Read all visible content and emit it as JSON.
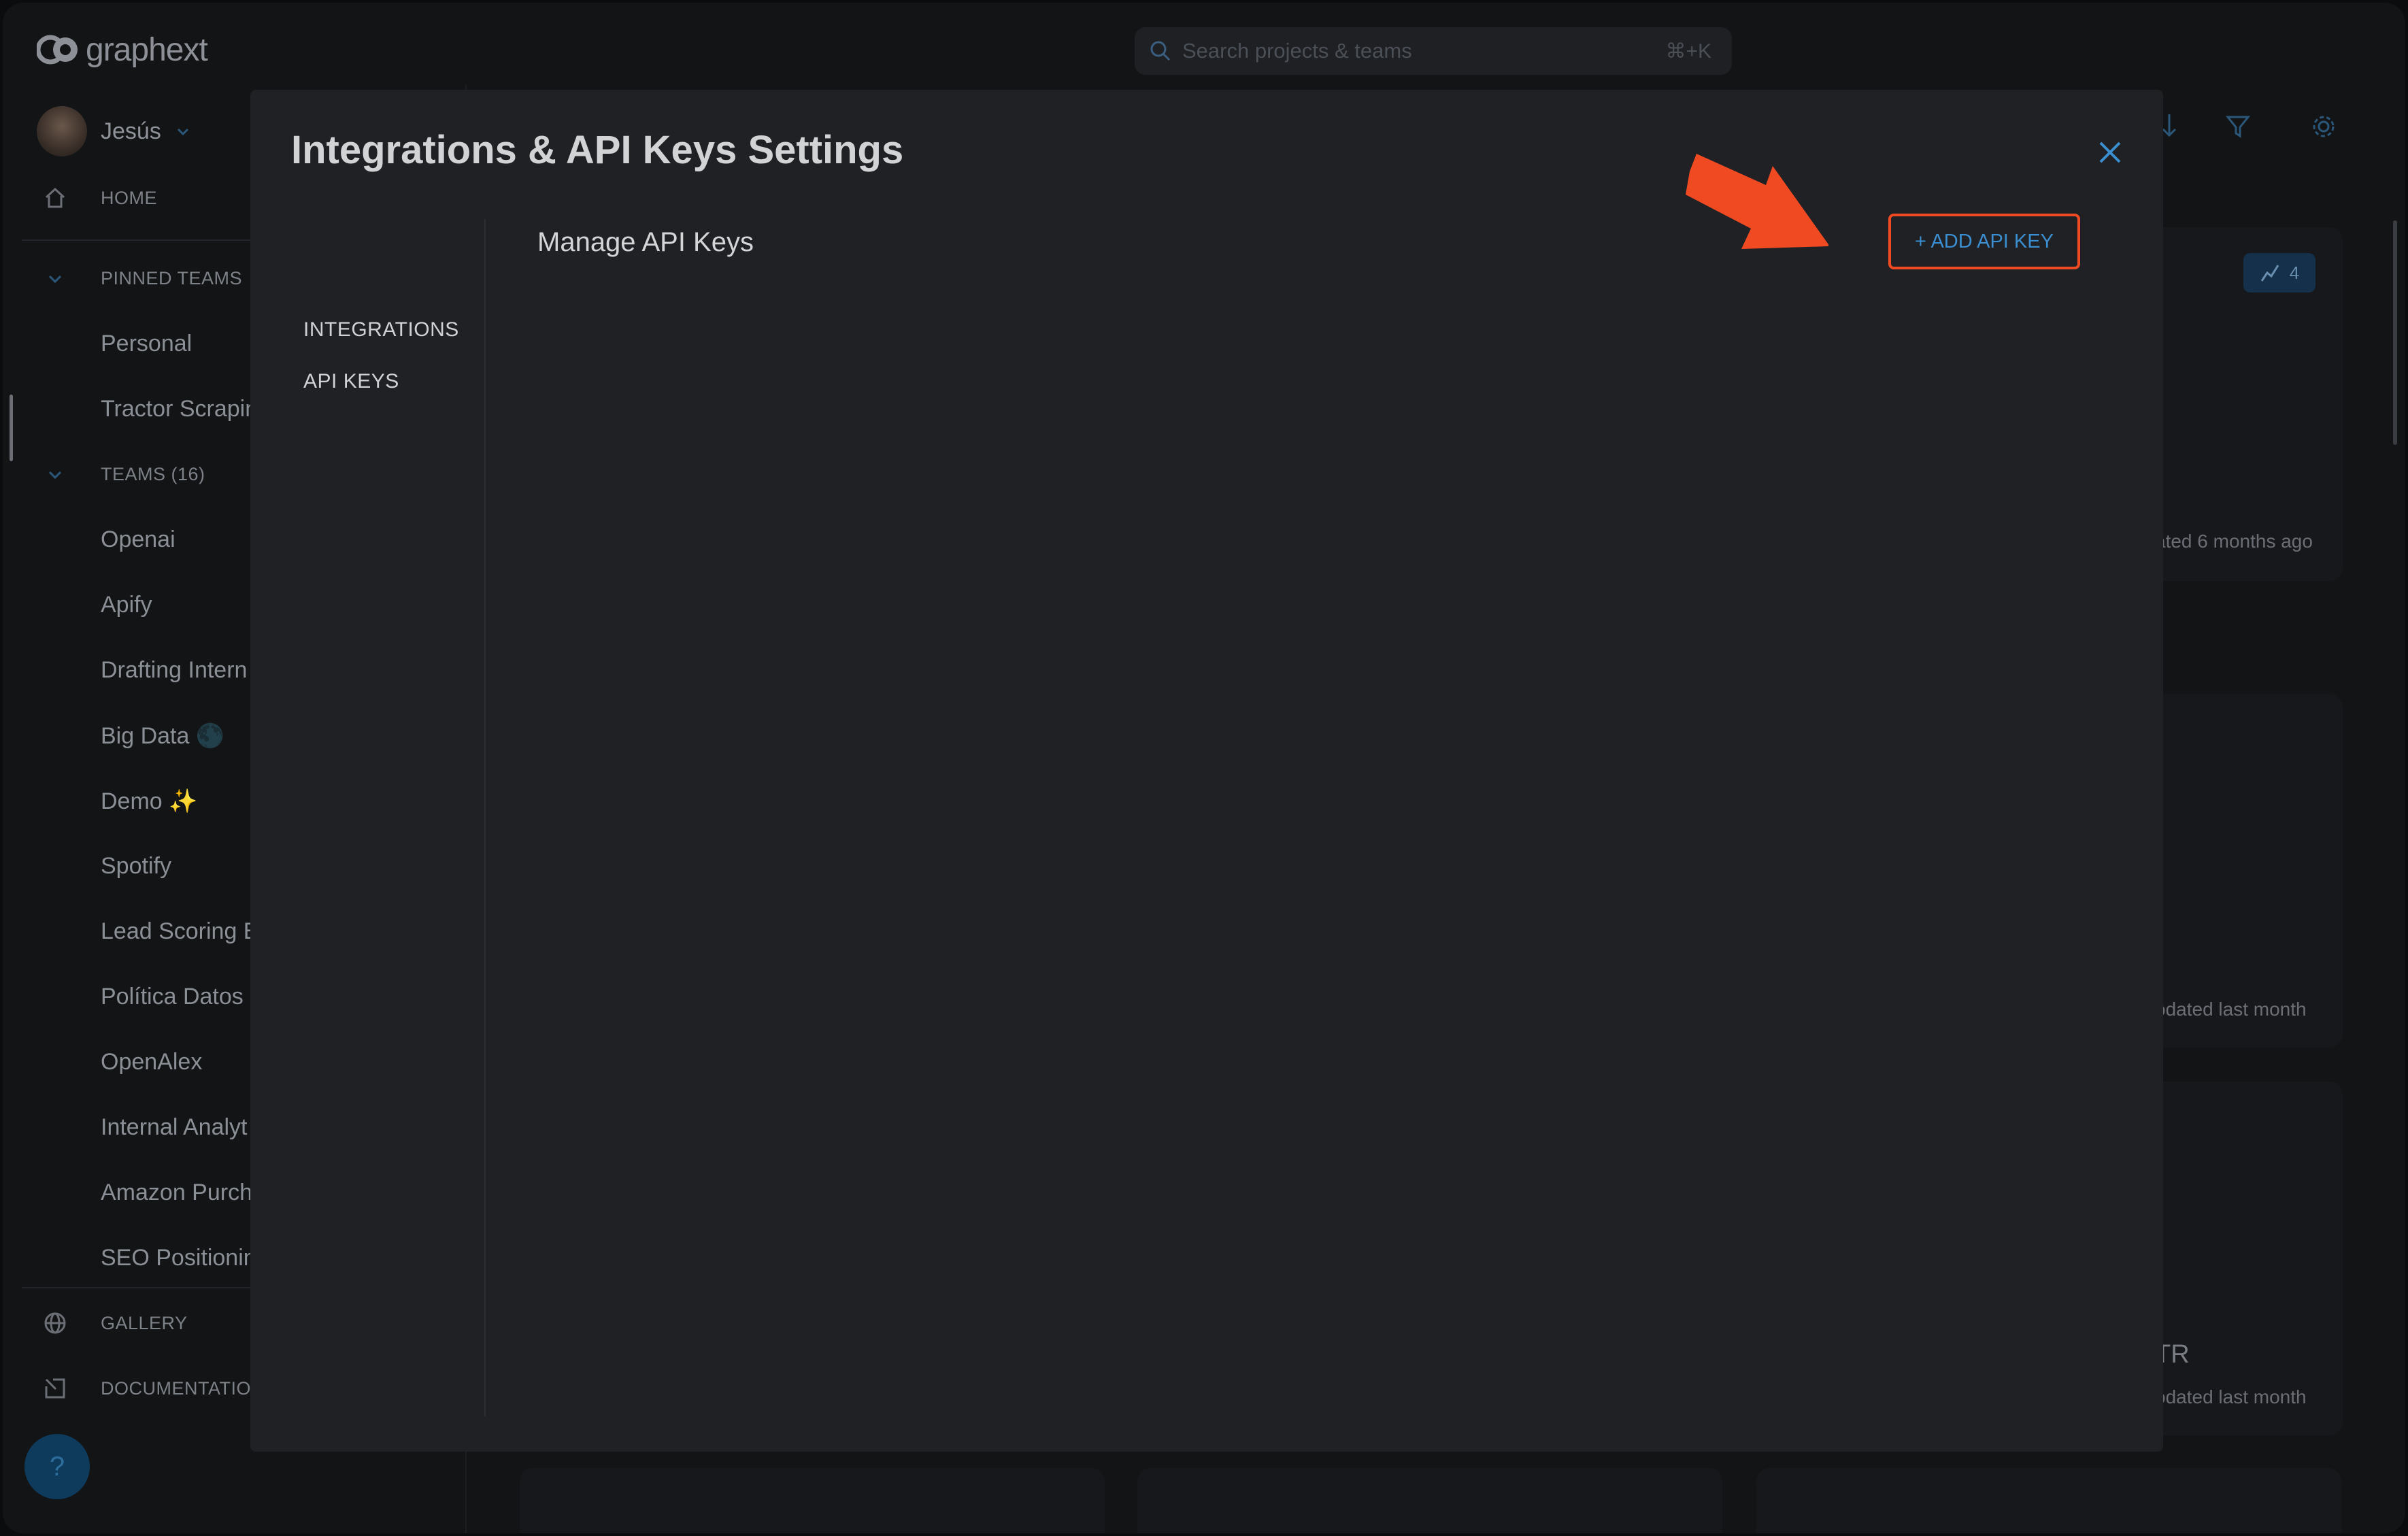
{
  "app": {
    "logo_text": "graphext",
    "search_placeholder": "Search projects & teams",
    "search_shortcut": "⌘+K"
  },
  "sidebar": {
    "user_name": "Jesús",
    "home_label": "HOME",
    "pinned_header": "PINNED TEAMS",
    "pinned_items": [
      "Personal",
      "Tractor Scrapin"
    ],
    "teams_header": "TEAMS (16)",
    "team_items": [
      "Openai",
      "Apify",
      "Drafting Intern",
      "Big Data 🌑",
      "Demo ✨",
      "Spotify",
      "Lead Scoring E",
      "Política Datos",
      "OpenAlex",
      "Internal Analyt",
      "Amazon Purch.",
      "SEO Positionin"
    ],
    "gallery_label": "GALLERY",
    "documentation_label": "DOCUMENTATIO",
    "help_label": "?"
  },
  "background": {
    "badge_count": "4",
    "card1_meta": "ated 6 months ago",
    "card2_meta": "odated last month",
    "card3_title": "TR",
    "card3_meta": "odated last month"
  },
  "modal": {
    "title": "Integrations & API Keys Settings",
    "tabs": [
      "INTEGRATIONS",
      "API KEYS"
    ],
    "section_title": "Manage API Keys",
    "add_button_label": "+ ADD API KEY",
    "highlight_color": "#f04a22",
    "accent_color": "#3b8ed0"
  }
}
